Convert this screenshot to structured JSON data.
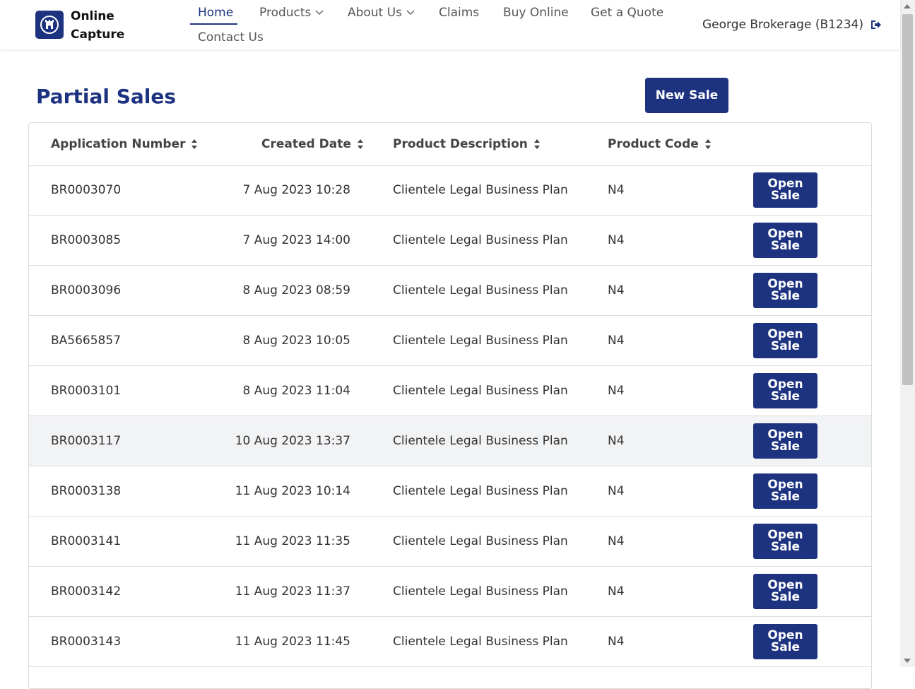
{
  "header": {
    "brand_line1": "Online",
    "brand_line2": "Capture",
    "nav": [
      {
        "label": "Home",
        "active": true
      },
      {
        "label": "Products",
        "dropdown": true
      },
      {
        "label": "About Us",
        "dropdown": true
      },
      {
        "label": "Claims"
      },
      {
        "label": "Buy Online"
      },
      {
        "label": "Get a Quote"
      },
      {
        "label": "Contact Us"
      }
    ],
    "user": "George Brokerage (B1234)",
    "logout_icon": "sign-out-icon"
  },
  "page": {
    "title": "Partial Sales",
    "new_sale_label": "New Sale"
  },
  "table": {
    "columns": [
      "Application Number",
      "Created Date",
      "Product Description",
      "Product Code"
    ],
    "sort_icon": "sort-icon",
    "open_line1": "Open",
    "open_line2": "Sale",
    "rows": [
      {
        "app": "BR0003070",
        "date": "7 Aug 2023 10:28",
        "desc": "Clientele Legal Business Plan",
        "code": "N4"
      },
      {
        "app": "BR0003085",
        "date": "7 Aug 2023 14:00",
        "desc": "Clientele Legal Business Plan",
        "code": "N4"
      },
      {
        "app": "BR0003096",
        "date": "8 Aug 2023 08:59",
        "desc": "Clientele Legal Business Plan",
        "code": "N4"
      },
      {
        "app": "BA5665857",
        "date": "8 Aug 2023 10:05",
        "desc": "Clientele Legal Business Plan",
        "code": "N4"
      },
      {
        "app": "BR0003101",
        "date": "8 Aug 2023 11:04",
        "desc": "Clientele Legal Business Plan",
        "code": "N4"
      },
      {
        "app": "BR0003117",
        "date": "10 Aug 2023 13:37",
        "desc": "Clientele Legal Business Plan",
        "code": "N4",
        "highlighted": true
      },
      {
        "app": "BR0003138",
        "date": "11 Aug 2023 10:14",
        "desc": "Clientele Legal Business Plan",
        "code": "N4"
      },
      {
        "app": "BR0003141",
        "date": "11 Aug 2023 11:35",
        "desc": "Clientele Legal Business Plan",
        "code": "N4"
      },
      {
        "app": "BR0003142",
        "date": "11 Aug 2023 11:37",
        "desc": "Clientele Legal Business Plan",
        "code": "N4"
      },
      {
        "app": "BR0003143",
        "date": "11 Aug 2023 11:45",
        "desc": "Clientele Legal Business Plan",
        "code": "N4"
      }
    ]
  },
  "colors": {
    "primary": "#1e3380",
    "row_highlight": "#f2f3f5",
    "border": "#dcdcdc"
  }
}
